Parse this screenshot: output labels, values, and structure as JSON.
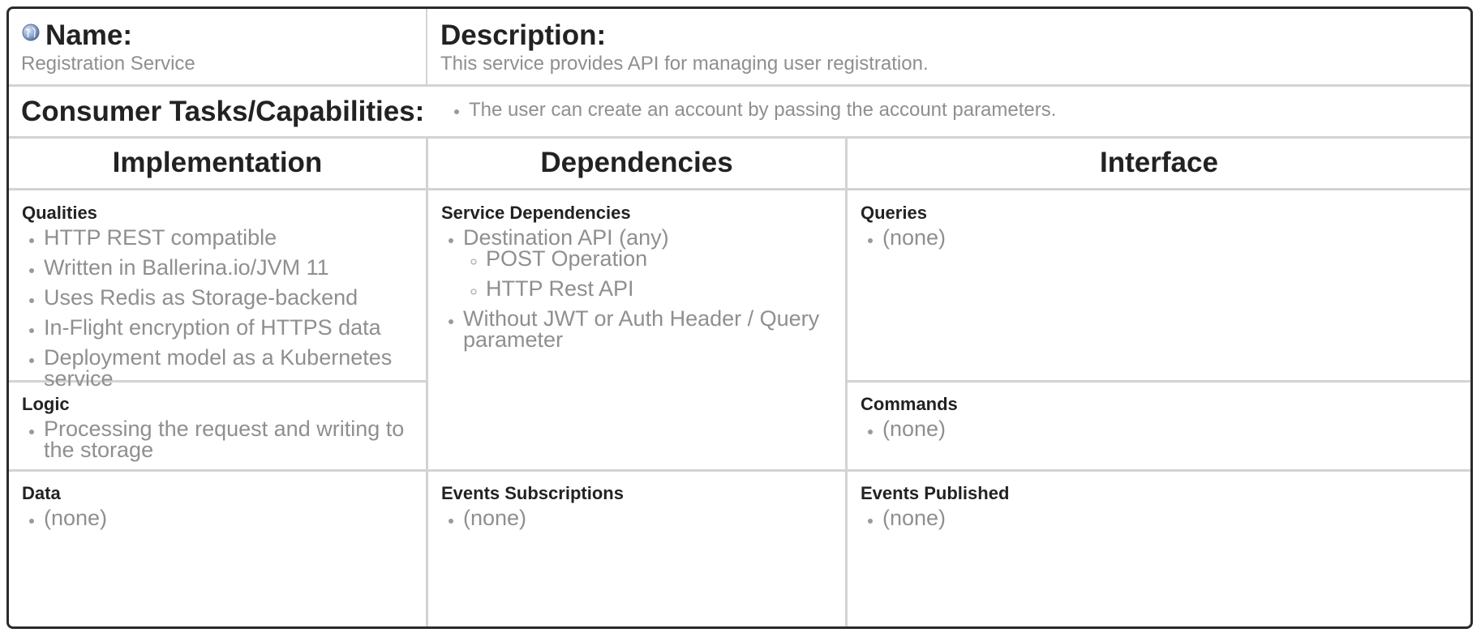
{
  "header": {
    "name_label": "Name:",
    "name_value": "Registration Service",
    "name_icon": "globe-icon",
    "description_label": "Description:",
    "description_value": "This service provides API for managing user registration."
  },
  "consumer": {
    "label": "Consumer Tasks/Capabilities:",
    "items": [
      "The user can create an account by passing the account parameters."
    ]
  },
  "columns": {
    "implementation": "Implementation",
    "dependencies": "Dependencies",
    "interface": "Interface"
  },
  "implementation": {
    "qualities": {
      "title": "Qualities",
      "items": [
        "HTTP REST compatible",
        "Written in Ballerina.io/JVM 11",
        "Uses Redis as Storage-backend",
        "In-Flight encryption of HTTPS data",
        "Deployment model as a Kubernetes service"
      ]
    },
    "logic": {
      "title": "Logic",
      "items": [
        "Processing the request and writing to the storage"
      ]
    },
    "data": {
      "title": "Data",
      "items": [
        "(none)"
      ]
    }
  },
  "dependencies": {
    "service_dependencies": {
      "title": "Service Dependencies",
      "item1": "Destination API (any)",
      "item1_sub": [
        "POST Operation",
        "HTTP Rest API"
      ],
      "item2": "Without JWT or Auth Header / Query parameter"
    },
    "events_subscriptions": {
      "title": "Events Subscriptions",
      "items": [
        "(none)"
      ]
    }
  },
  "interface": {
    "queries": {
      "title": "Queries",
      "items": [
        "(none)"
      ]
    },
    "commands": {
      "title": "Commands",
      "items": [
        "(none)"
      ]
    },
    "events_published": {
      "title": "Events Published",
      "items": [
        "(none)"
      ]
    }
  },
  "colors": {
    "border": "#2b2b2b",
    "grid": "#d3d3d3",
    "muted_text": "#8f8f8f",
    "heading_text": "#222222"
  }
}
